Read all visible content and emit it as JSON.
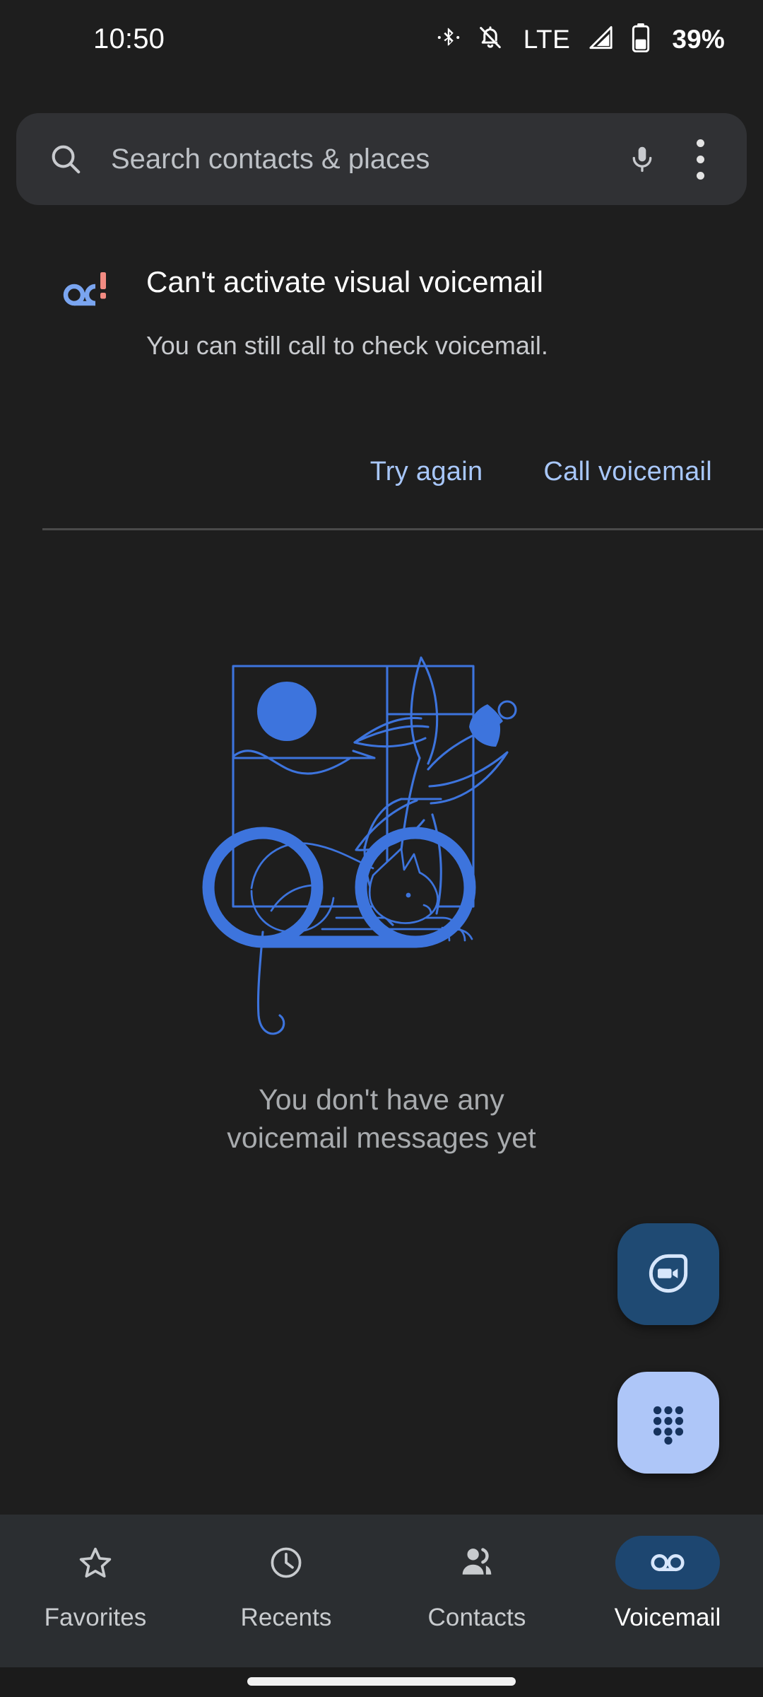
{
  "statusbar": {
    "clock": "10:50",
    "network_label": "LTE",
    "battery_percent": "39%",
    "icons": [
      "bluetooth-icon",
      "notifications-off-icon",
      "signal-icon",
      "battery-icon"
    ]
  },
  "search": {
    "placeholder": "Search contacts & places",
    "search_icon": "search-icon",
    "voice_icon": "microphone-icon",
    "overflow_icon": "more-vertical-icon"
  },
  "error_banner": {
    "icon": "voicemail-alert-icon",
    "title": "Can't activate visual voicemail",
    "subtitle": "You can still call to check voicemail.",
    "actions": [
      {
        "label": "Try again",
        "name": "try-again-button"
      },
      {
        "label": "Call voicemail",
        "name": "call-voicemail-button"
      }
    ]
  },
  "empty_state": {
    "illustration": "cat-window-voicemail-illustration",
    "line1": "You don't have any",
    "line2": "voicemail messages yet"
  },
  "fabs": [
    {
      "name": "video-call-fab",
      "icon": "video-camera-icon",
      "bg": "#1f4a73"
    },
    {
      "name": "dialpad-fab",
      "icon": "dialpad-icon",
      "bg": "#aec6f8"
    }
  ],
  "bottom_nav": {
    "items": [
      {
        "label": "Favorites",
        "icon": "star-outline-icon",
        "active": false
      },
      {
        "label": "Recents",
        "icon": "clock-outline-icon",
        "active": false
      },
      {
        "label": "Contacts",
        "icon": "people-icon",
        "active": false
      },
      {
        "label": "Voicemail",
        "icon": "voicemail-icon",
        "active": true
      }
    ]
  },
  "colors": {
    "background": "#1e1e1e",
    "surface": "#303134",
    "nav_surface": "#2b2e31",
    "accent_blue": "#4285f4",
    "link_blue": "#a8c7fa",
    "active_pill": "#1d4670",
    "alert_red": "#f28b82",
    "text_primary": "#ffffff",
    "text_secondary": "#c8cace"
  }
}
